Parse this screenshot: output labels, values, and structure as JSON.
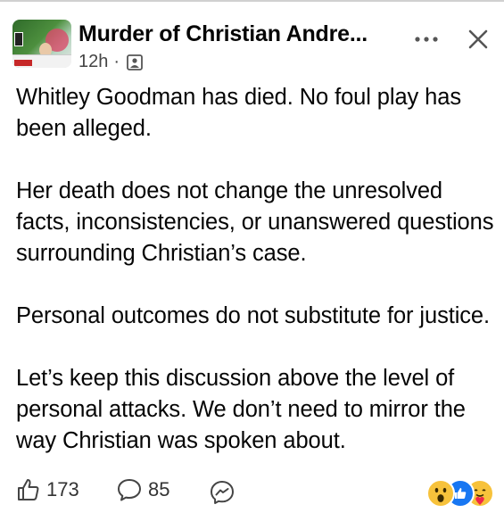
{
  "post": {
    "page_name": "Murder of Christian Andre...",
    "time": "12h",
    "separator": "·",
    "audience_icon": "page-audience-icon",
    "paragraphs": [
      "Whitley Goodman has died.  No foul play has been alleged.",
      "Her death does not change the unresolved facts, inconsistencies, or unanswered questions surrounding Christian’s case.",
      "Personal outcomes do not substitute for justice.",
      "Let’s keep this discussion above the level of personal attacks. We don’t need to mirror the way Christian was spoken about."
    ]
  },
  "header": {
    "more_icon": "more-options-icon",
    "close_icon": "close-icon"
  },
  "footer": {
    "likes": "173",
    "comments": "85",
    "like_icon": "thumbs-up-icon",
    "comment_icon": "comment-icon",
    "share_icon": "messenger-icon",
    "reactions": [
      "wow-reaction-icon",
      "like-reaction-icon",
      "care-reaction-icon"
    ]
  },
  "colors": {
    "text": "#050505",
    "meta": "#444444",
    "like_blue": "#1877f2",
    "wow_yellow": "#f7c23b"
  }
}
